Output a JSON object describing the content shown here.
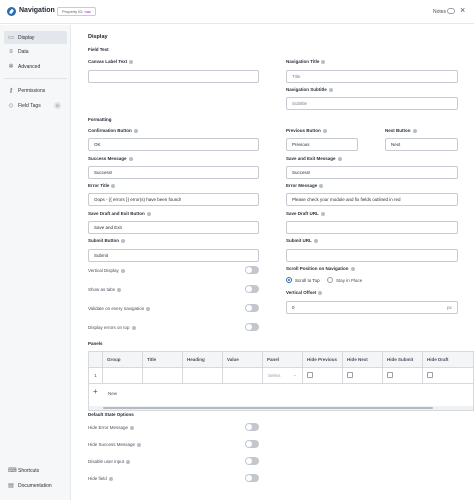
{
  "header": {
    "title": "Navigation",
    "property_label": "Property ID:",
    "property_value": "nav",
    "notes_label": "Notes",
    "close_glyph": "×"
  },
  "sidebar": {
    "items": [
      {
        "label": "Display",
        "icon": "monitor-icon",
        "active": true
      },
      {
        "label": "Data",
        "icon": "database-icon"
      },
      {
        "label": "Advanced",
        "icon": "gear-icon"
      },
      {
        "label": "Permissions",
        "icon": "key-icon"
      },
      {
        "label": "Field Tags",
        "icon": "tag-icon",
        "badge": "0"
      }
    ],
    "footer": [
      {
        "label": "Shortcuts",
        "icon": "keyboard-icon"
      },
      {
        "label": "Documentation",
        "icon": "book-icon"
      }
    ]
  },
  "main": {
    "section_title": "Display",
    "field_text_title": "Field Text",
    "canvas_label": "Canvas Label Text",
    "canvas_value": "",
    "nav_title_label": "Navigation Title",
    "nav_title_placeholder": "Title",
    "nav_subtitle_label": "Navigation Subtitle",
    "nav_subtitle_placeholder": "Subtitle",
    "formatting_title": "Formatting",
    "confirm_label": "Confirmation Button",
    "confirm_value": "OK",
    "prev_label": "Previous Button",
    "prev_value": "Previous",
    "next_label": "Next Button",
    "next_value": "Next",
    "success_label": "Success Message",
    "success_value": "Success!",
    "save_exit_msg_label": "Save and Exit Message",
    "save_exit_msg_value": "Success!",
    "error_title_label": "Error Title",
    "error_title_value": "Oops - {{ errors }} error(s) have been found!",
    "error_msg_label": "Error Message",
    "error_msg_value": "Please check your module and fix fields outlined in red",
    "save_draft_label": "Save Draft and Exit Button",
    "save_draft_value": "Save and Exit",
    "save_draft_url_label": "Save Draft URL",
    "save_draft_url_value": "",
    "submit_label": "Submit Button",
    "submit_value": "Submit",
    "submit_url_label": "Submit URL",
    "submit_url_value": "",
    "toggles": [
      {
        "label": "Vertical Display",
        "on": false
      },
      {
        "label": "Show as tabs",
        "on": false
      },
      {
        "label": "Validate on every navigation",
        "on": false
      },
      {
        "label": "Display errors on top",
        "on": false
      }
    ],
    "scroll_label": "Scroll Position on Navigation",
    "scroll_options": [
      {
        "label": "Scroll to Top",
        "selected": true
      },
      {
        "label": "Stay in Place",
        "selected": false
      }
    ],
    "offset_label": "Vertical Offset",
    "offset_value": "0",
    "offset_unit": "px",
    "panels_title": "Panels",
    "panels_columns": [
      "Group",
      "Title",
      "Heading",
      "Value",
      "Panel",
      "Hide Previous",
      "Hide Next",
      "Hide Submit",
      "Hide Draft"
    ],
    "panels_row_index": "1",
    "panels_select_placeholder": "Select",
    "panels_new_label": "New",
    "default_state_title": "Default State Options",
    "state_toggles": [
      {
        "label": "Hide Error Message",
        "on": false
      },
      {
        "label": "Hide Success Message",
        "on": false
      },
      {
        "label": "Disable user input",
        "on": false
      },
      {
        "label": "Hide field",
        "on": false
      }
    ]
  },
  "colors": {
    "accent": "#2b6cb0",
    "badge_value": "#8a2be2",
    "sidebar_bg": "#f6f7f9"
  }
}
